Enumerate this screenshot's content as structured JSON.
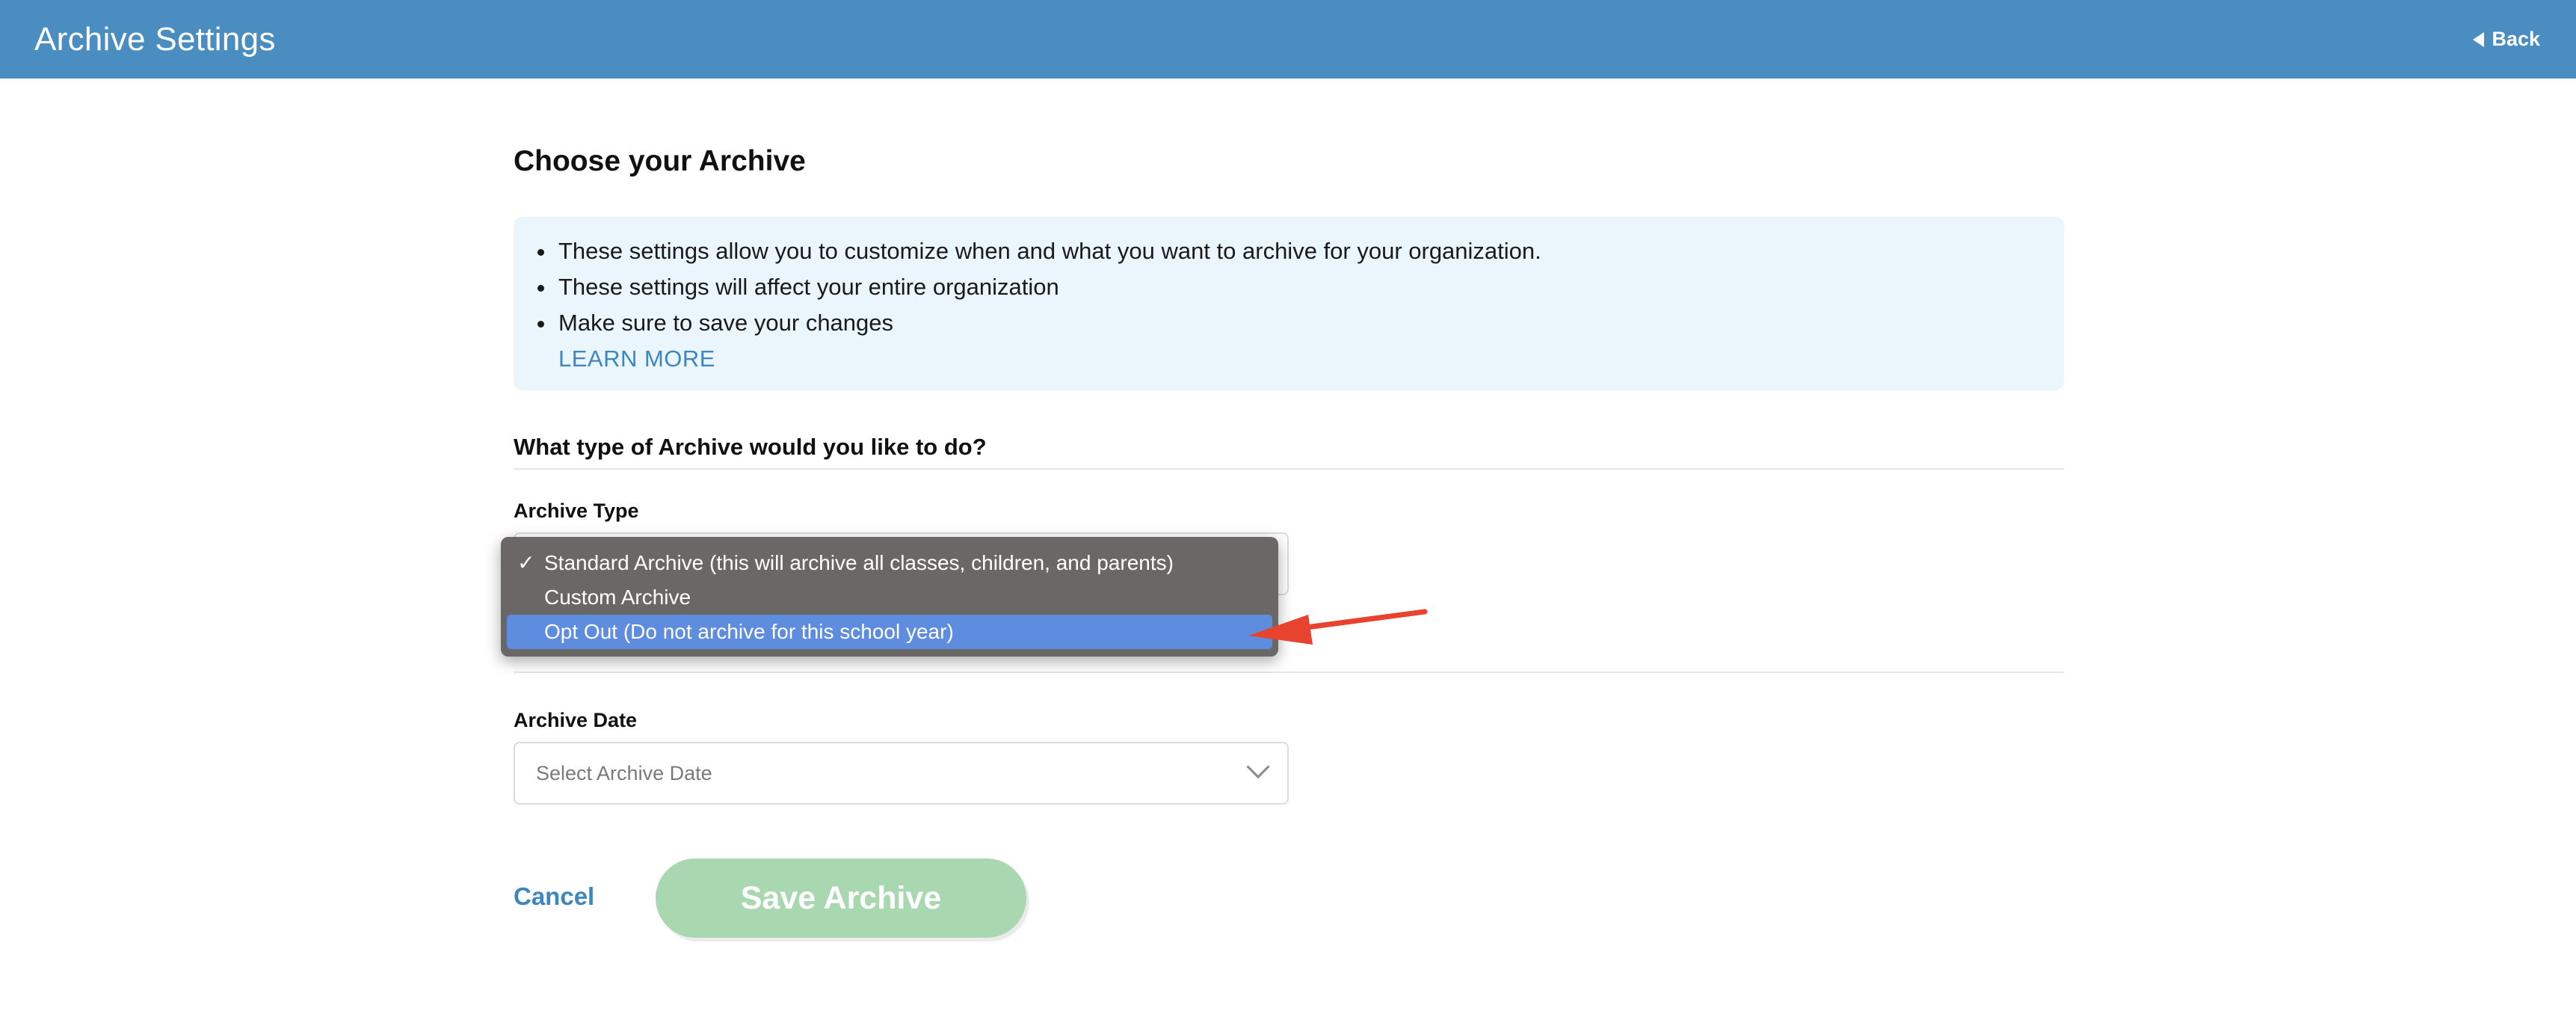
{
  "header": {
    "title": "Archive Settings",
    "back_label": "Back"
  },
  "main": {
    "page_title": "Choose your Archive",
    "info": {
      "items": [
        "These settings allow you to customize when and what you want to archive for your organization.",
        "These settings will affect your entire organization",
        "Make sure to save your changes"
      ],
      "learn_more": "LEARN MORE"
    },
    "archive_type_section": {
      "heading": "What type of Archive would you like to do?",
      "label": "Archive Type",
      "dropdown": {
        "options": [
          {
            "label": "Standard Archive (this will archive all classes, children, and parents)",
            "checked": true
          },
          {
            "label": "Custom Archive",
            "checked": false
          },
          {
            "label": "Opt Out (Do not archive for this school year)",
            "highlighted": true
          }
        ],
        "check_glyph": "✓"
      }
    },
    "archive_date_section": {
      "label": "Archive Date",
      "placeholder": "Select Archive Date"
    },
    "actions": {
      "cancel_label": "Cancel",
      "save_label": "Save Archive"
    }
  },
  "colors": {
    "header_bg": "#4a8dc0",
    "info_bg": "#eaf6fc",
    "link": "#3d86bf",
    "save_button_bg": "#a9d8b0",
    "dropdown_bg": "#6b6767",
    "dropdown_highlight": "#5e8cde",
    "annotation_arrow": "#e8432e"
  }
}
